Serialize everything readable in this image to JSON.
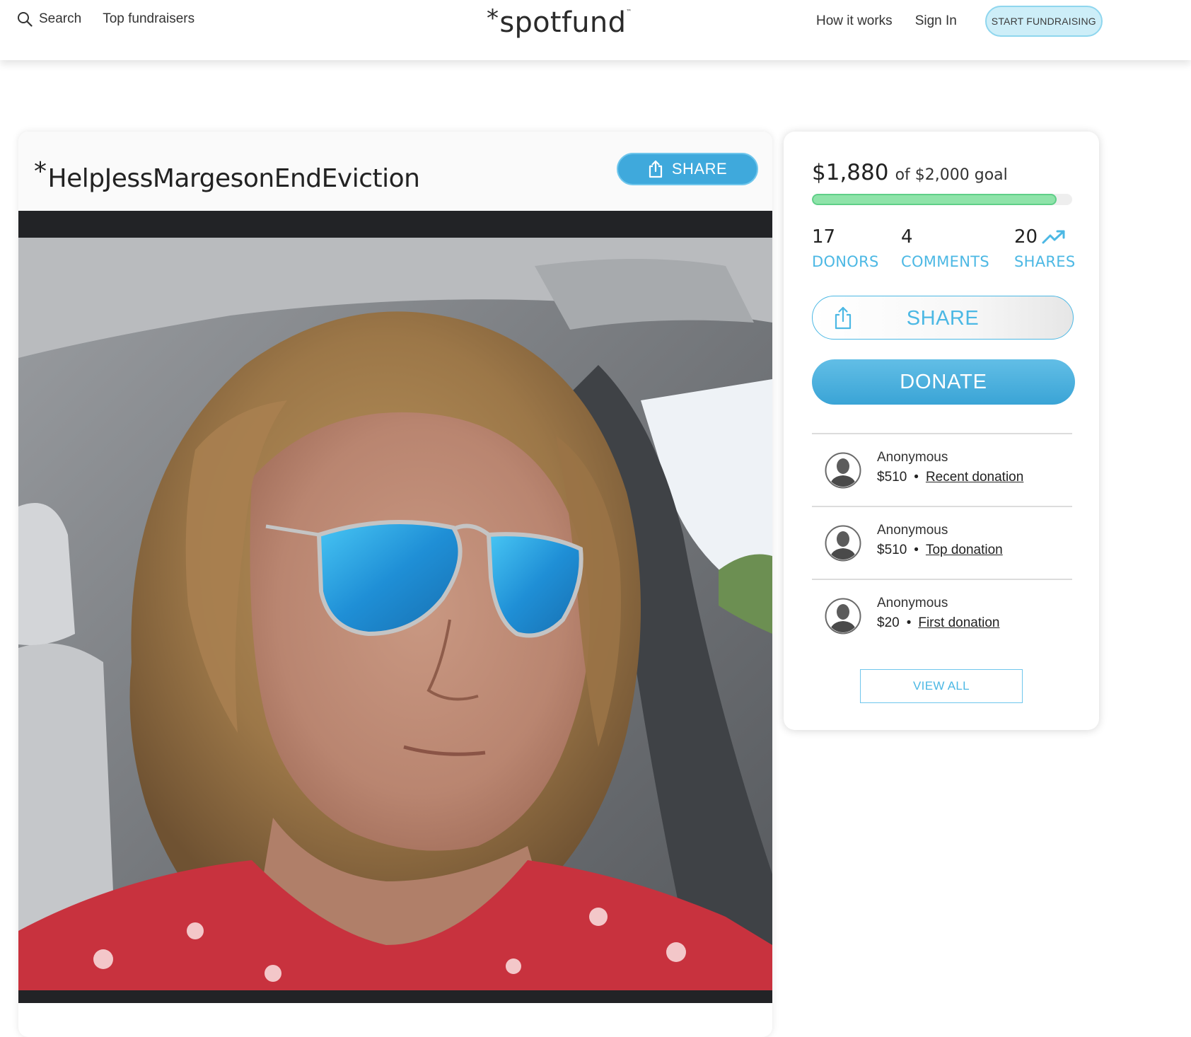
{
  "nav": {
    "search_label": "Search",
    "top_fundraisers_label": "Top fundraisers",
    "logo_text": "spotfund",
    "logo_asterisk": "*",
    "logo_tm": "™",
    "how_it_works_label": "How it works",
    "sign_in_label": "Sign In",
    "start_fundraising_label": "START FUNDRAISING"
  },
  "campaign": {
    "title_asterisk": "*",
    "title": "HelpJessMargesonEndEviction",
    "share_label": "SHARE"
  },
  "summary": {
    "raised": "$1,880",
    "goal_text": "of $2,000 goal",
    "progress_fraction": 0.94,
    "donors_count": "17",
    "donors_label": "DONORS",
    "comments_count": "4",
    "comments_label": "COMMENTS",
    "shares_count": "20",
    "shares_label": "SHARES",
    "share_button_label": "SHARE",
    "donate_button_label": "DONATE",
    "view_all_label": "VIEW ALL"
  },
  "donations": [
    {
      "name": "Anonymous",
      "amount": "$510",
      "dot": "•",
      "kind": "Recent donation"
    },
    {
      "name": "Anonymous",
      "amount": "$510",
      "dot": "•",
      "kind": "Top donation"
    },
    {
      "name": "Anonymous",
      "amount": "$20",
      "dot": "•",
      "kind": "First donation"
    }
  ],
  "colors": {
    "accent_blue": "#4cb8e4",
    "donate_blue": "#3aa4d6",
    "progress_green": "#8ee3a9",
    "start_button_bg": "#cdeef8"
  },
  "icons": {
    "search": "search-icon",
    "share": "share-icon",
    "trending": "trending-up-icon",
    "avatar": "avatar-icon"
  }
}
